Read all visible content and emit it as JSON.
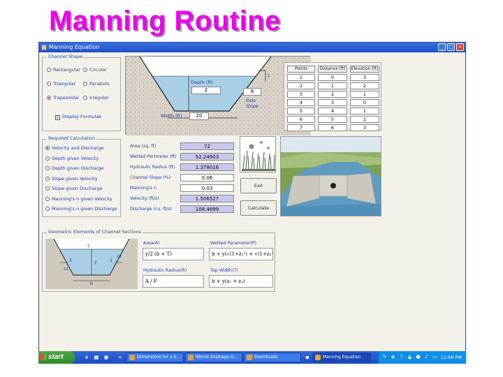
{
  "slide": {
    "title": "Manning Routine"
  },
  "window": {
    "title": "Manning Equation"
  },
  "channel_shape": {
    "legend": "Channel Shape",
    "options": [
      {
        "label": "Rectangular",
        "selected": false
      },
      {
        "label": "Circular",
        "selected": false
      },
      {
        "label": "Triangular",
        "selected": false
      },
      {
        "label": "Parabolic",
        "selected": false
      },
      {
        "label": "Trapezoidal",
        "selected": true
      },
      {
        "label": "Irregular",
        "selected": false
      }
    ],
    "display_formulae": {
      "label": "Display Formulae",
      "checked": true,
      "mark": "✓"
    }
  },
  "diagram": {
    "depth_label": "Depth (ft)",
    "depth_value": "2",
    "width_label": "Width (ft)",
    "width_value": "20",
    "side_slope_label_1": "Side",
    "side_slope_label_2": "Slope",
    "side_slope_value": "8",
    "slope_ratio": "1"
  },
  "points_table": {
    "headers": [
      "Points",
      "Distance (ft)",
      "Elevation (ft)"
    ],
    "points": [
      "1",
      "2",
      "3",
      "4",
      "5",
      "6",
      "7"
    ],
    "distance": [
      "0",
      "1",
      "2",
      "3",
      "4",
      "5",
      "6"
    ],
    "elevation": [
      "3",
      "2",
      "1",
      "0",
      "1",
      "2",
      "3"
    ]
  },
  "required_calc": {
    "legend": "Required Calculation",
    "options": [
      {
        "label": "Velocity and Discharge",
        "selected": true
      },
      {
        "label": "Depth given Velocity",
        "selected": false
      },
      {
        "label": "Depth given Discharge",
        "selected": false
      },
      {
        "label": "Slope given Velocity",
        "selected": false
      },
      {
        "label": "Slope given Discharge",
        "selected": false
      },
      {
        "label": "Manning's n given Velocity",
        "selected": false
      },
      {
        "label": "Manning's n given Discharge",
        "selected": false
      }
    ]
  },
  "results": {
    "rows": [
      {
        "label": "Area (sq. ft)",
        "value": "72",
        "kind": "calc"
      },
      {
        "label": "Wetted Perimeter (ft)",
        "value": "52.24903",
        "kind": "calc"
      },
      {
        "label": "Hydraulic Radius (ft)",
        "value": "1.378016",
        "kind": "calc"
      },
      {
        "label": "Channel Slope (%)",
        "value": "0.06",
        "kind": "input"
      },
      {
        "label": "Manning's n",
        "value": "0.03",
        "kind": "input"
      },
      {
        "label": "Velocity (ft/s)",
        "value": "1.506527",
        "kind": "calc"
      },
      {
        "label": "Discharge (cu. ft/s)",
        "value": "108.4699",
        "kind": "calc"
      }
    ]
  },
  "buttons": {
    "exit": "Exit",
    "calculate": "Calculate"
  },
  "geometric": {
    "legend": "Geometric Elements of Channel Sections",
    "area_label": "Area(A)",
    "area_formula": "y/2 (b + T)",
    "wetted_label": "Wetted Parameter(P)",
    "wetted_formula": "b + y(√(1+z₁²) + √(1+z₂²))",
    "hydraulic_label": "Hydraulic Radius(R)",
    "hydraulic_formula": "A / P",
    "top_width_label": "Top Width(T)",
    "top_width_formula": "b + y(z₁ + z₂)",
    "fig_labels": {
      "T": "T",
      "y": "y",
      "b": "b",
      "z1": "z1",
      "z2": "z2",
      "one_a": "1",
      "one_b": "1"
    }
  },
  "taskbar": {
    "start_label": "start",
    "tasks": [
      {
        "label": "Dimensions for a 9...",
        "active": false
      },
      {
        "label": "Illinois Drainage G...",
        "active": false
      },
      {
        "label": "Downloads",
        "active": false
      },
      {
        "label": "Manning Equation",
        "active": true
      }
    ],
    "overflow": "»",
    "clock": "12:59 PM"
  },
  "colors": {
    "title_magenta": "#ee00ee",
    "label_blue": "#1f3fa8",
    "calc_field": "#c8c8ee",
    "water": "#a8cfe6"
  }
}
